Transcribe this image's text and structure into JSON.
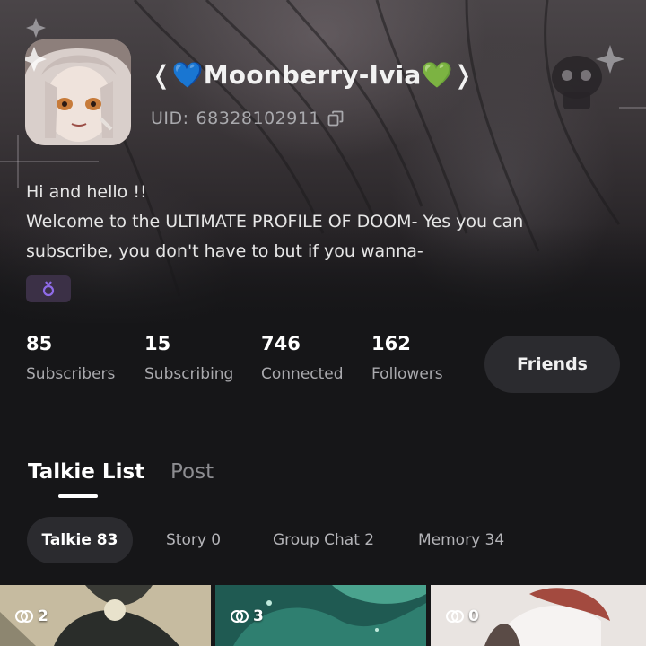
{
  "profile": {
    "username": "❬💙Moonberry-Ivia💚❭",
    "uid_label": "UID:",
    "uid_value": "68328102911",
    "bio_line1": "Hi and hello !!",
    "bio_line2": "Welcome to the ULTIMATE PROFILE OF DOOM- Yes you can",
    "bio_line3": "subscribe, you don't have to but if you wanna-",
    "gender_icon": "female-icon",
    "gender_color": "#8f6be8"
  },
  "stats": [
    {
      "value": "85",
      "label": "Subscribers"
    },
    {
      "value": "15",
      "label": "Subscribing"
    },
    {
      "value": "746",
      "label": "Connected"
    },
    {
      "value": "162",
      "label": "Followers"
    }
  ],
  "friends_label": "Friends",
  "tabs": [
    {
      "label": "Talkie List",
      "active": true
    },
    {
      "label": "Post",
      "active": false
    }
  ],
  "filters": [
    {
      "label": "Talkie 83",
      "active": true
    },
    {
      "label": "Story 0",
      "active": false
    },
    {
      "label": "Group Chat 2",
      "active": false
    },
    {
      "label": "Memory 34",
      "active": false
    }
  ],
  "cards": [
    {
      "count": "2",
      "icon": "connections-icon"
    },
    {
      "count": "3",
      "icon": "connections-icon"
    },
    {
      "count": "0",
      "icon": "connections-icon"
    }
  ],
  "colors": {
    "background": "#161618",
    "button_bg": "#2b2b2f",
    "muted_text": "#a9a9ad",
    "gender_tag_bg": "#3b3046"
  }
}
